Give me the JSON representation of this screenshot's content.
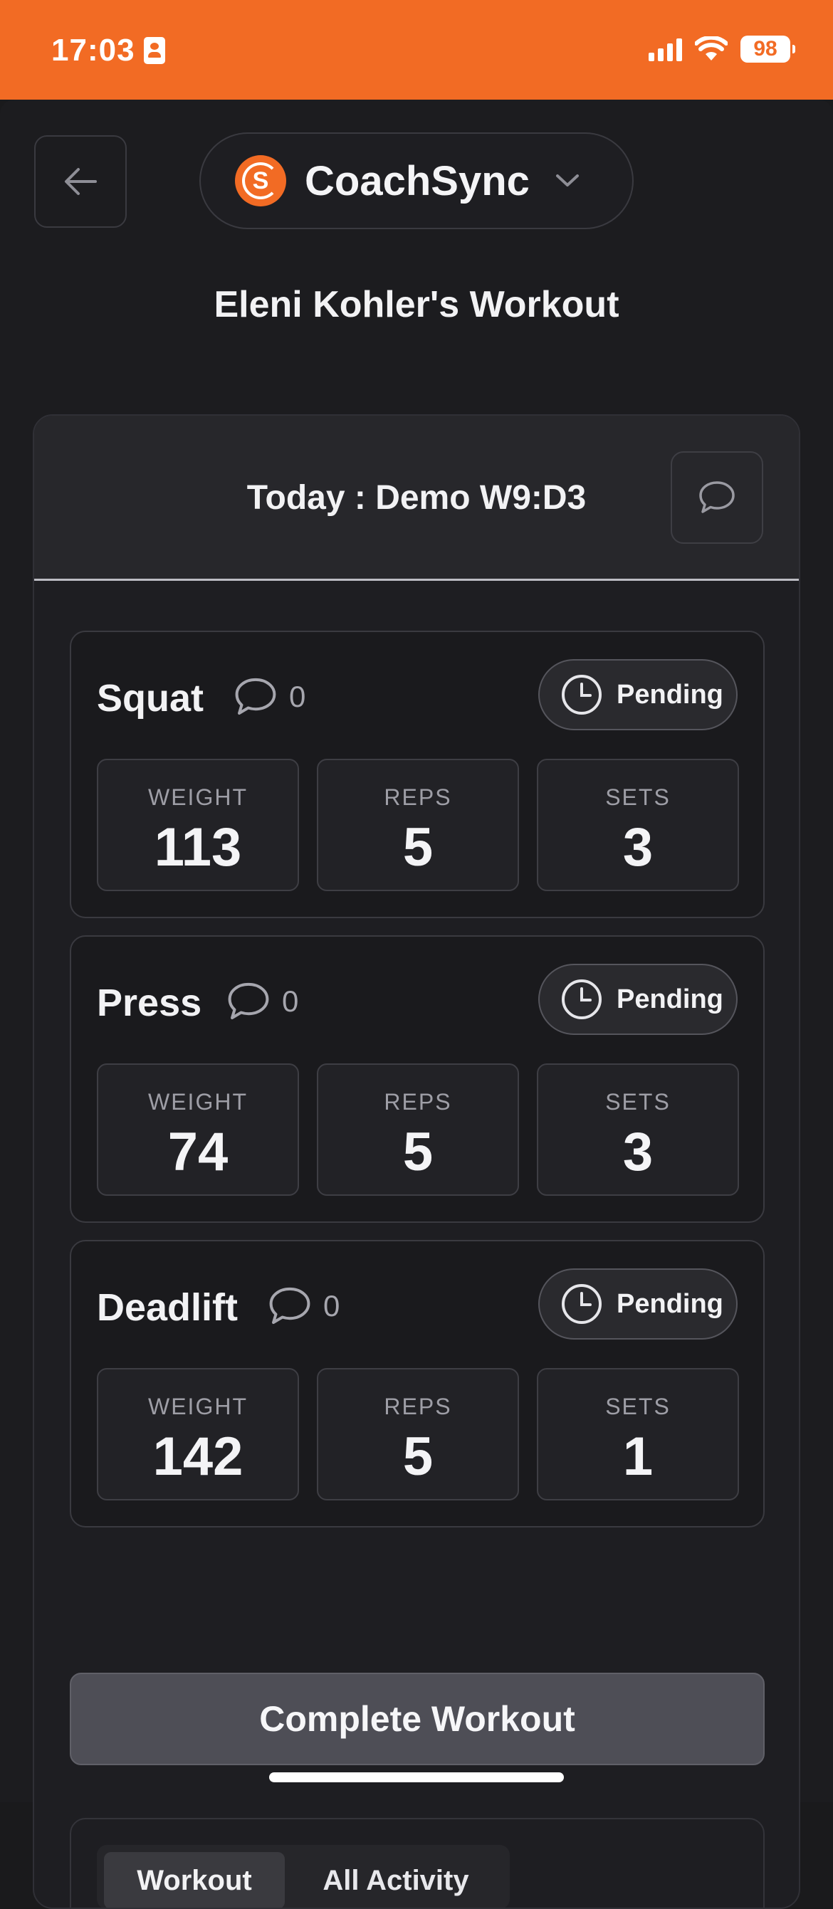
{
  "status_bar": {
    "time": "17:03",
    "battery": "98"
  },
  "header": {
    "brand_logo_letter": "S",
    "brand_name": "CoachSync",
    "page_title": "Eleni Kohler's Workout"
  },
  "workout": {
    "title": "Today : Demo W9:D3",
    "exercises": [
      {
        "name": "Squat",
        "comments": "0",
        "status": "Pending",
        "stats": [
          {
            "label": "WEIGHT",
            "value": "113"
          },
          {
            "label": "REPS",
            "value": "5"
          },
          {
            "label": "SETS",
            "value": "3"
          }
        ]
      },
      {
        "name": "Press",
        "comments": "0",
        "status": "Pending",
        "stats": [
          {
            "label": "WEIGHT",
            "value": "74"
          },
          {
            "label": "REPS",
            "value": "5"
          },
          {
            "label": "SETS",
            "value": "3"
          }
        ]
      },
      {
        "name": "Deadlift",
        "comments": "0",
        "status": "Pending",
        "stats": [
          {
            "label": "WEIGHT",
            "value": "142"
          },
          {
            "label": "REPS",
            "value": "5"
          },
          {
            "label": "SETS",
            "value": "1"
          }
        ]
      }
    ],
    "complete_label": "Complete Workout"
  },
  "tabs": [
    {
      "label": "Workout",
      "active": true
    },
    {
      "label": "All Activity",
      "active": false
    }
  ],
  "colors": {
    "accent": "#f26b24",
    "background": "#1c1c1f"
  }
}
